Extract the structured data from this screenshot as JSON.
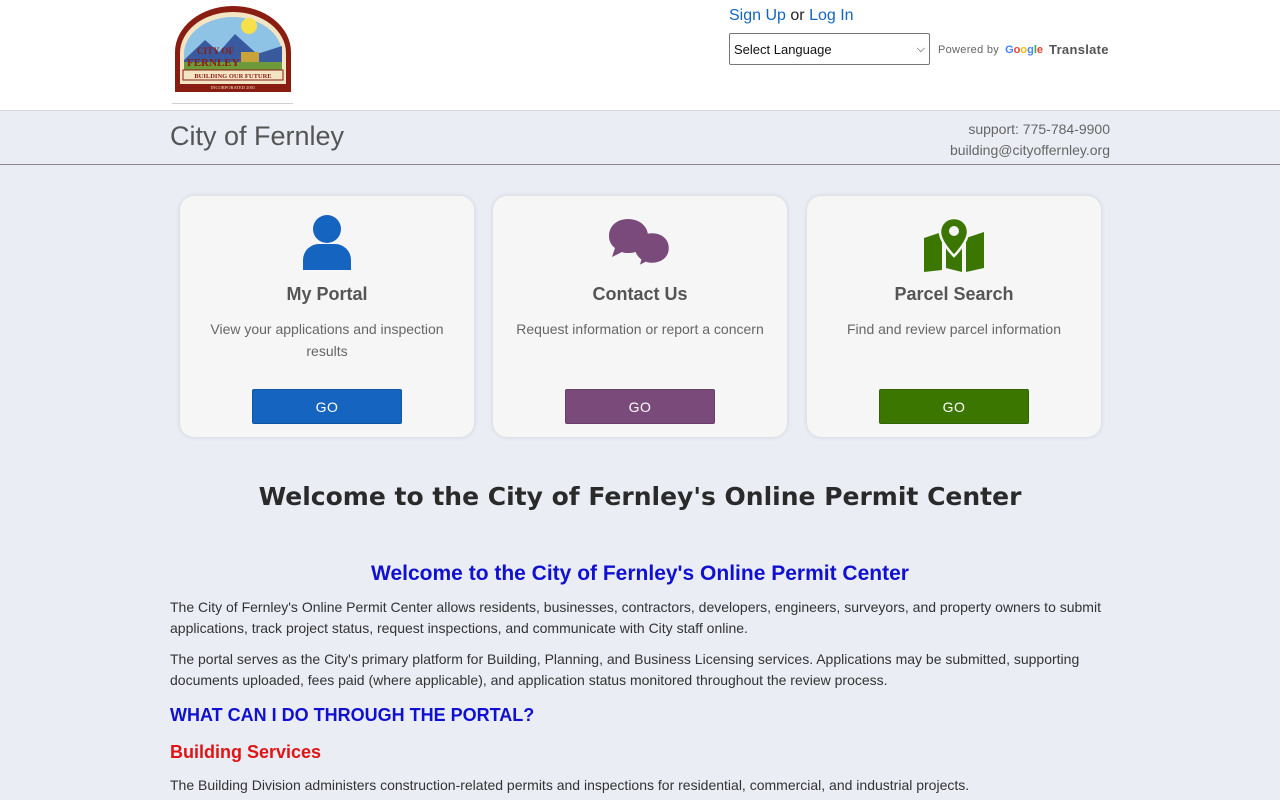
{
  "header": {
    "logo": {
      "text_top": "CITY OF",
      "text_main": "FERNLEY",
      "banner": "BUILDING OUR FUTURE",
      "footer": "INCORPORATED 2001"
    },
    "signup_label": "Sign Up",
    "or_label": "or",
    "login_label": "Log In",
    "language_select": "Select Language",
    "powered_by": "Powered by",
    "google_label": "Google",
    "translate_label": "Translate"
  },
  "titlebar": {
    "city_title": "City of Fernley",
    "support_phone": "support: 775-784-9900",
    "support_email": "building@cityoffernley.org"
  },
  "cards": [
    {
      "title": "My Portal",
      "description": "View your applications and inspection results",
      "button": "GO",
      "color": "#1565c0",
      "icon": "user-icon"
    },
    {
      "title": "Contact Us",
      "description": "Request information or report a concern",
      "button": "GO",
      "color": "#7a4a7a",
      "icon": "chat-bubbles-icon"
    },
    {
      "title": "Parcel Search",
      "description": "Find and review parcel information",
      "button": "GO",
      "color": "#3a7600",
      "icon": "map-pin-icon"
    }
  ],
  "content": {
    "main_heading": "Welcome to the City of Fernley's Online Permit Center",
    "sub_heading": "Welcome to the City of Fernley's Online Permit Center",
    "para1": "The City of Fernley's Online Permit Center allows residents, businesses, contractors, developers, engineers, surveyors, and property owners to submit applications, track project status, request inspections, and communicate with City staff online.",
    "para2": "The portal serves as the City's primary platform for Building, Planning, and Business Licensing services. Applications may be submitted, supporting documents uploaded, fees paid (where applicable), and application status monitored throughout the review process.",
    "what_heading": "WHAT CAN I DO THROUGH THE PORTAL?",
    "building_heading": "Building Services",
    "para3": "The Building Division administers construction-related permits and inspections for residential, commercial, and industrial projects."
  },
  "colors": {
    "link": "#1565c0",
    "heading_blue": "#1010d0",
    "heading_red": "#e01414",
    "background": "#eaedf4"
  }
}
